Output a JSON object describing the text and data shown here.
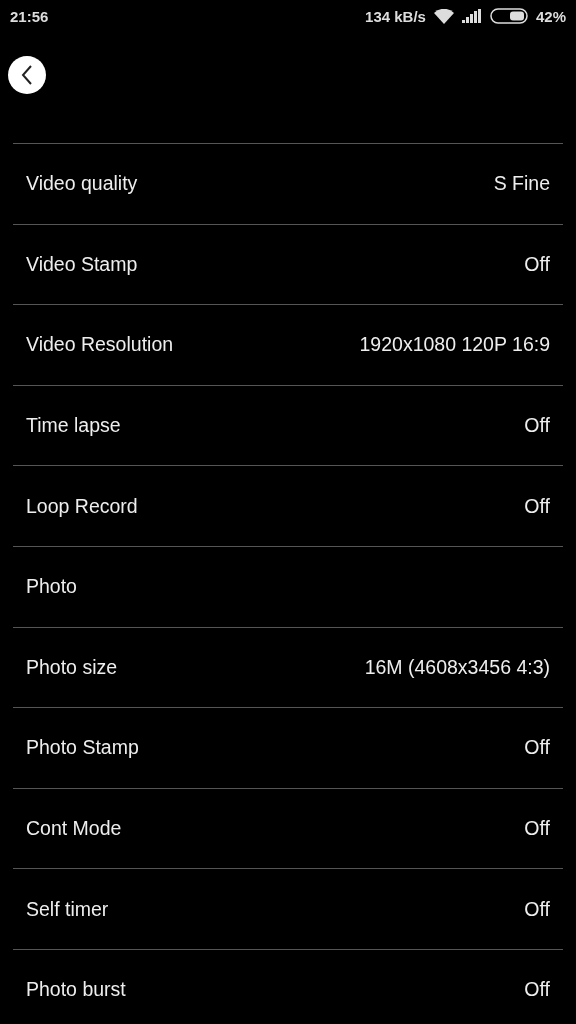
{
  "status_bar": {
    "time": "21:56",
    "speed": "134 kB/s",
    "battery": "42%"
  },
  "settings": [
    {
      "label": "Video quality",
      "value": "S Fine"
    },
    {
      "label": "Video Stamp",
      "value": "Off"
    },
    {
      "label": "Video Resolution",
      "value": "1920x1080 120P 16:9"
    },
    {
      "label": "Time lapse",
      "value": "Off"
    },
    {
      "label": "Loop Record",
      "value": "Off"
    },
    {
      "label": "Photo"
    },
    {
      "label": "Photo size",
      "value": "16M (4608x3456 4:3)"
    },
    {
      "label": "Photo Stamp",
      "value": "Off"
    },
    {
      "label": "Cont Mode",
      "value": "Off"
    },
    {
      "label": "Self timer",
      "value": "Off"
    },
    {
      "label": "Photo burst",
      "value": "Off"
    }
  ]
}
